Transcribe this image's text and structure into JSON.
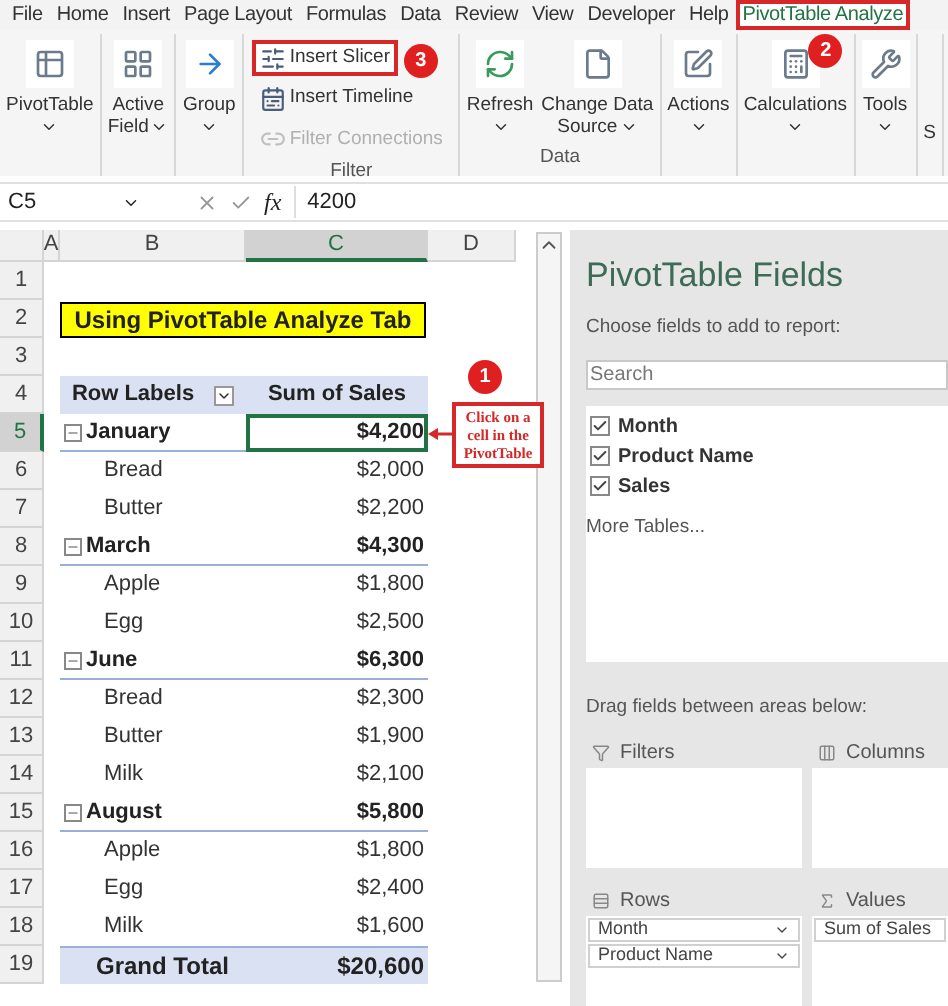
{
  "menu_tabs": [
    {
      "label": "File",
      "selected": false,
      "highlighted": false
    },
    {
      "label": "Home",
      "selected": false,
      "highlighted": false
    },
    {
      "label": "Insert",
      "selected": false,
      "highlighted": false
    },
    {
      "label": "Page Layout",
      "selected": false,
      "highlighted": false
    },
    {
      "label": "Formulas",
      "selected": false,
      "highlighted": false
    },
    {
      "label": "Data",
      "selected": false,
      "highlighted": false
    },
    {
      "label": "Review",
      "selected": false,
      "highlighted": false
    },
    {
      "label": "View",
      "selected": false,
      "highlighted": false
    },
    {
      "label": "Developer",
      "selected": false,
      "highlighted": false
    },
    {
      "label": "Help",
      "selected": false,
      "highlighted": false
    },
    {
      "label": "PivotTable Analyze",
      "selected": true,
      "highlighted": true,
      "badge": "2"
    }
  ],
  "ribbon_groups": [
    {
      "buttons": [
        {
          "kind": "large",
          "lines": [
            "PivotTable"
          ],
          "dropdown": true
        }
      ]
    },
    {
      "buttons": [
        {
          "kind": "large",
          "lines": [
            "Active",
            "Field"
          ],
          "dropdown": true
        }
      ]
    },
    {
      "buttons": [
        {
          "kind": "large",
          "lines": [
            "Group"
          ],
          "dropdown": true
        }
      ]
    },
    {
      "label": "Filter",
      "buttons": [
        {
          "kind": "small",
          "lines": [
            "Insert Slicer"
          ],
          "disabled": false,
          "highlighted": true,
          "badge": "3"
        },
        {
          "kind": "small",
          "lines": [
            "Insert Timeline"
          ],
          "disabled": false,
          "highlighted": false
        },
        {
          "kind": "small",
          "lines": [
            "Filter Connections"
          ],
          "disabled": true,
          "highlighted": false
        }
      ]
    },
    {
      "label": "Data",
      "buttons": [
        {
          "kind": "large",
          "lines": [
            "Refresh"
          ],
          "dropdown": true
        },
        {
          "kind": "large",
          "lines": [
            "Change Data",
            "Source"
          ],
          "dropdown": true
        }
      ]
    },
    {
      "buttons": [
        {
          "kind": "large",
          "lines": [
            "Actions"
          ],
          "dropdown": true
        }
      ]
    },
    {
      "buttons": [
        {
          "kind": "large",
          "lines": [
            "Calculations"
          ],
          "dropdown": true
        }
      ]
    },
    {
      "buttons": [
        {
          "kind": "large",
          "lines": [
            "Tools"
          ],
          "dropdown": true
        }
      ]
    },
    {
      "buttons": [
        {
          "kind": "cut",
          "lines": [
            "S"
          ]
        }
      ]
    }
  ],
  "formula_bar": {
    "name_box": "C5",
    "function_label": "fx",
    "value": "4200"
  },
  "columns": [
    {
      "label": "A",
      "selected": false
    },
    {
      "label": "B",
      "selected": false
    },
    {
      "label": "C",
      "selected": true
    },
    {
      "label": "D",
      "selected": false
    }
  ],
  "rows": [
    {
      "number": "1",
      "selected": false,
      "kind": "blank"
    },
    {
      "number": "2",
      "selected": false,
      "kind": "title",
      "text": "Using PivotTable Analyze Tab"
    },
    {
      "number": "3",
      "selected": false,
      "kind": "blank"
    },
    {
      "number": "4",
      "selected": false,
      "kind": "header",
      "label": "Row Labels",
      "value": "Sum of Sales"
    },
    {
      "number": "5",
      "selected": true,
      "kind": "group",
      "label": "January",
      "value": "$4,200"
    },
    {
      "number": "6",
      "selected": false,
      "kind": "item",
      "label": "Bread",
      "value": "$2,000"
    },
    {
      "number": "7",
      "selected": false,
      "kind": "item",
      "label": "Butter",
      "value": "$2,200"
    },
    {
      "number": "8",
      "selected": false,
      "kind": "group",
      "label": "March",
      "value": "$4,300"
    },
    {
      "number": "9",
      "selected": false,
      "kind": "item",
      "label": "Apple",
      "value": "$1,800"
    },
    {
      "number": "10",
      "selected": false,
      "kind": "item",
      "label": "Egg",
      "value": "$2,500"
    },
    {
      "number": "11",
      "selected": false,
      "kind": "group",
      "label": "June",
      "value": "$6,300"
    },
    {
      "number": "12",
      "selected": false,
      "kind": "item",
      "label": "Bread",
      "value": "$2,300"
    },
    {
      "number": "13",
      "selected": false,
      "kind": "item",
      "label": "Butter",
      "value": "$1,900"
    },
    {
      "number": "14",
      "selected": false,
      "kind": "item",
      "label": "Milk",
      "value": "$2,100"
    },
    {
      "number": "15",
      "selected": false,
      "kind": "group",
      "label": "August",
      "value": "$5,800"
    },
    {
      "number": "16",
      "selected": false,
      "kind": "item",
      "label": "Apple",
      "value": "$1,800"
    },
    {
      "number": "17",
      "selected": false,
      "kind": "item",
      "label": "Egg",
      "value": "$2,400"
    },
    {
      "number": "18",
      "selected": false,
      "kind": "item",
      "label": "Milk",
      "value": "$1,600"
    },
    {
      "number": "19",
      "selected": false,
      "kind": "total",
      "label": "Grand Total",
      "value": "$20,600"
    }
  ],
  "callout": {
    "badge": "1",
    "text": "Click on a cell in the PivotTable"
  },
  "field_panel": {
    "title": "PivotTable Fields",
    "subtitle": "Choose fields to add to report:",
    "search_placeholder": "Search",
    "fields": [
      {
        "label": "Month",
        "checked": true
      },
      {
        "label": "Product Name",
        "checked": true
      },
      {
        "label": "Sales",
        "checked": true
      }
    ],
    "more_tables": "More Tables...",
    "drag_hint": "Drag fields between areas below:",
    "areas": [
      {
        "name": "Filters"
      },
      {
        "name": "Columns"
      },
      {
        "name": "Rows",
        "items": [
          "Month",
          "Product Name"
        ]
      },
      {
        "name": "Values",
        "items": [
          "Sum of Sales"
        ]
      }
    ]
  }
}
